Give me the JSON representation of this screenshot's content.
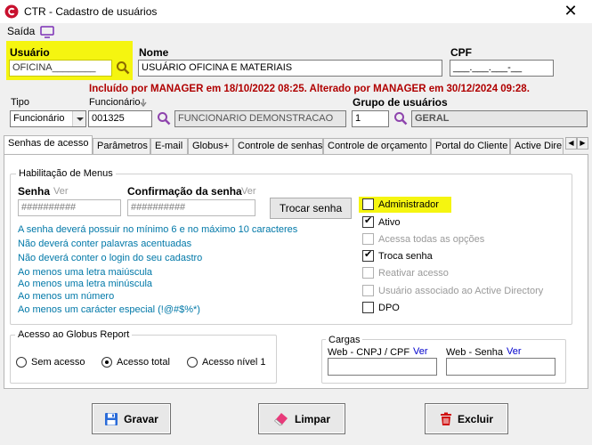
{
  "window": {
    "title": "CTR - Cadastro de usuários",
    "close": "✕"
  },
  "menubar": {
    "saida": "Saída"
  },
  "header": {
    "usuario_label": "Usuário",
    "usuario_value": "OFICINA________",
    "nome_label": "Nome",
    "nome_value": "USUÁRIO OFICINA E MATERIAIS",
    "cpf_label": "CPF",
    "cpf_value": "___.___.___-__",
    "audit": "Incluído por MANAGER em 18/10/2022 08:25. Alterado por MANAGER em 30/12/2024 09:28.",
    "tipo_label": "Tipo",
    "tipo_value": "Funcionário",
    "funcionario_label": "Funcionário",
    "funcionario_code": "001325",
    "funcionario_name": "FUNCIONARIO DEMONSTRACAO",
    "grupo_label": "Grupo de usuários",
    "grupo_code": "1",
    "grupo_name": "GERAL"
  },
  "tabs": [
    "Senhas de acesso",
    "Parâmetros",
    "E-mail",
    "Globus+",
    "Controle de senhas",
    "Controle de orçamento",
    "Portal do Cliente",
    "Active Dire"
  ],
  "menus_group": {
    "title": "Habilitação de Menus",
    "senha_label": "Senha",
    "senha_ver": "Ver",
    "senha_value": "##########",
    "confirm_label": "Confirmação da senha",
    "confirm_ver": "Ver",
    "confirm_value": "##########",
    "trocar_button": "Trocar senha",
    "rules": [
      "A senha deverá possuir no mínimo 6 e no máximo 10 caracteres",
      "Não deverá conter palavras acentuadas",
      "Não deverá conter o login do seu cadastro",
      "Ao menos uma letra maiúscula",
      "Ao menos uma letra minúscula",
      "Ao menos um número",
      "Ao menos um carácter especial (!@#$%*)"
    ],
    "checkboxes": [
      {
        "label": "Administrador",
        "checked": false,
        "enabled": true
      },
      {
        "label": "Ativo",
        "checked": true,
        "enabled": true
      },
      {
        "label": "Acessa todas as opções",
        "checked": false,
        "enabled": false
      },
      {
        "label": "Troca senha",
        "checked": true,
        "enabled": true
      },
      {
        "label": "Reativar acesso",
        "checked": false,
        "enabled": false
      },
      {
        "label": "Usuário associado ao Active Directory",
        "checked": false,
        "enabled": false
      },
      {
        "label": "DPO",
        "checked": false,
        "enabled": true
      }
    ]
  },
  "report_group": {
    "title": "Acesso ao Globus Report",
    "options": [
      {
        "label": "Sem acesso",
        "selected": false
      },
      {
        "label": "Acesso total",
        "selected": true
      },
      {
        "label": "Acesso nível 1",
        "selected": false
      }
    ]
  },
  "cargas_group": {
    "title": "Cargas",
    "web_cnpj_label": "Web - CNPJ / CPF",
    "web_cnpj_ver": "Ver",
    "web_senha_label": "Web - Senha",
    "web_senha_ver": "Ver"
  },
  "footer": {
    "gravar": "Gravar",
    "limpar": "Limpar",
    "excluir": "Excluir"
  },
  "colors": {
    "highlight": "#f5f510",
    "audit": "#b00000",
    "rules": "#0078a8",
    "link": "#0000cc"
  }
}
